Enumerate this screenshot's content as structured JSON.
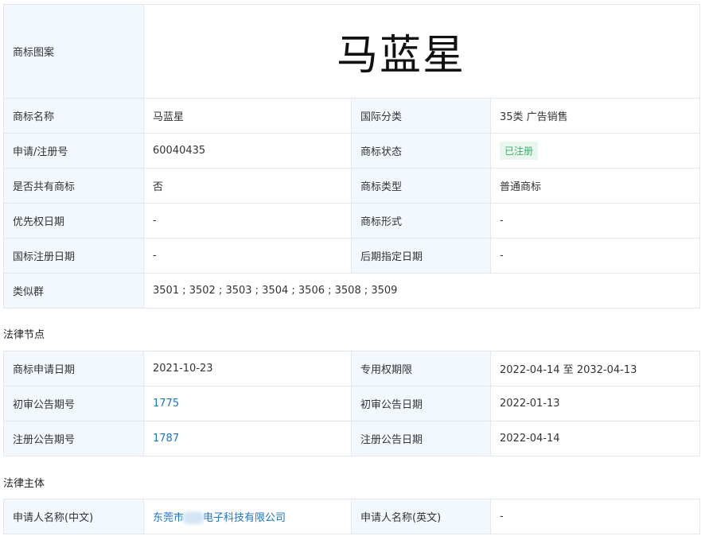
{
  "trademark": {
    "logo_label": "商标图案",
    "logo_text": "马蓝星",
    "rows": [
      {
        "l1": "商标名称",
        "v1": "马蓝星",
        "l2": "国际分类",
        "v2": "35类 广告销售"
      },
      {
        "l1": "申请/注册号",
        "v1": "60040435",
        "l2": "商标状态",
        "v2": "已注册"
      },
      {
        "l1": "是否共有商标",
        "v1": "否",
        "l2": "商标类型",
        "v2": "普通商标"
      },
      {
        "l1": "优先权日期",
        "v1": "-",
        "l2": "商标形式",
        "v2": "-"
      },
      {
        "l1": "国标注册日期",
        "v1": "-",
        "l2": "后期指定日期",
        "v2": "-"
      }
    ],
    "similar_label": "类似群",
    "similar_value": "3501 ; 3502 ; 3503 ; 3504 ; 3506 ; 3508 ; 3509"
  },
  "legal_nodes": {
    "title": "法律节点",
    "rows": [
      {
        "l1": "商标申请日期",
        "v1": "2021-10-23",
        "l2": "专用权期限",
        "v2": "2022-04-14 至 2032-04-13"
      },
      {
        "l1": "初审公告期号",
        "v1": "1775",
        "l2": "初审公告日期",
        "v2": "2022-01-13"
      },
      {
        "l1": "注册公告期号",
        "v1": "1787",
        "l2": "注册公告日期",
        "v2": "2022-04-14"
      }
    ]
  },
  "legal_subject": {
    "title": "法律主体",
    "rows": [
      {
        "l1": "申请人名称(中文)",
        "v1_prefix": "东莞市",
        "v1_suffix": "电子科技有限公司",
        "l2": "申请人名称(英文)",
        "v2": "-"
      }
    ]
  },
  "colors": {
    "label_bg": "#f2f8fd",
    "link": "#1c74c4",
    "status_green": "#3fae6e"
  }
}
